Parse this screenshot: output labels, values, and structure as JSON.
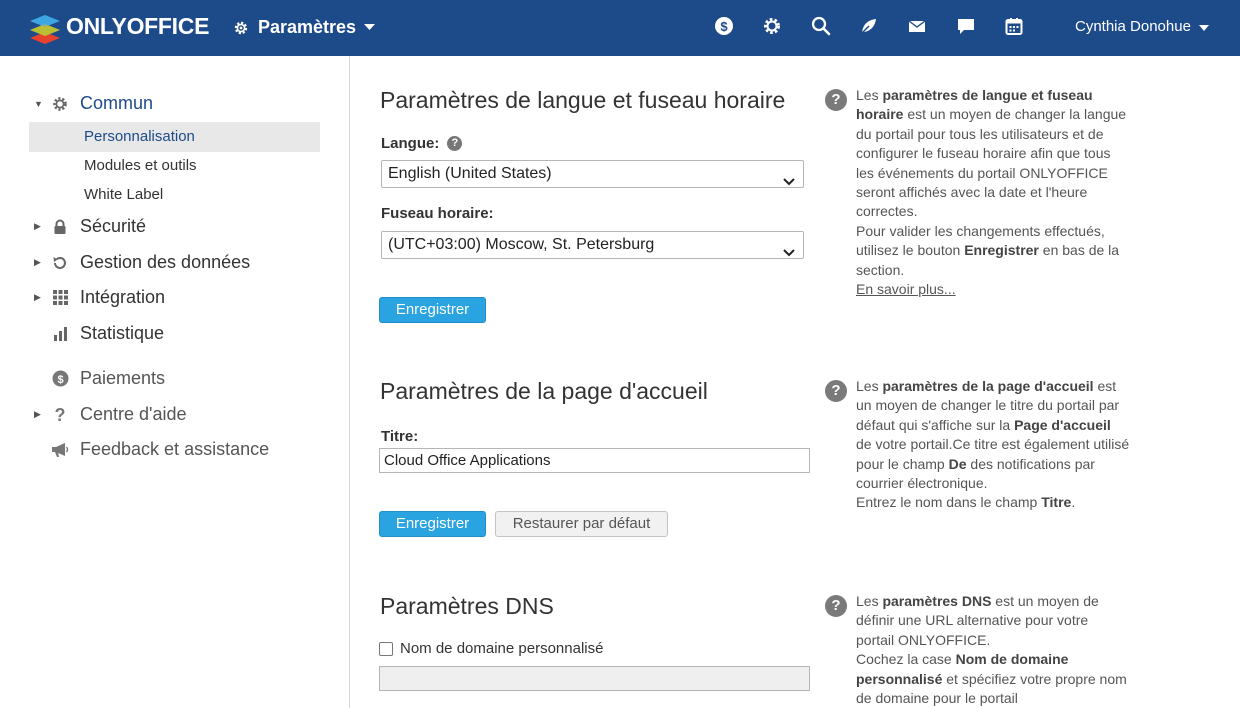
{
  "header": {
    "logo_text": "ONLYOFFICE",
    "module": "Paramètres",
    "user": "Cynthia Donohue",
    "icons": [
      "dollar-icon",
      "gear-icon",
      "search-icon",
      "feed-icon",
      "mail-icon",
      "chat-icon",
      "calendar-icon"
    ],
    "colors": {
      "bar": "#1d4b8a",
      "accent": "#2aa3e1"
    }
  },
  "sidebar": {
    "commun": "Commun",
    "sub": [
      "Personnalisation",
      "Modules et outils",
      "White Label"
    ],
    "securite": "Sécurité",
    "gestion": "Gestion des données",
    "integration": "Intégration",
    "statistique": "Statistique",
    "paiements": "Paiements",
    "centre_aide": "Centre d'aide",
    "feedback": "Feedback et assistance"
  },
  "langue_section": {
    "title": "Paramètres de langue et fuseau horaire",
    "language_label": "Langue:",
    "language_value": "English (United States)",
    "timezone_label": "Fuseau horaire:",
    "timezone_value": "(UTC+03:00) Moscow, St. Petersburg",
    "save": "Enregistrer",
    "help": {
      "p1": "Les ",
      "b1": "paramètres de langue et fuseau horaire",
      "p2": " est un moyen de changer la langue du portail pour tous les utilisateurs et de configurer le fuseau horaire afin que tous les événements du portail ONLYOFFICE seront affichés avec la date et l'heure correctes.",
      "p3": "Pour valider les changements effectués, utilisez le bouton ",
      "b2": "Enregistrer",
      "p4": " en bas de la section.",
      "link": "En savoir plus..."
    }
  },
  "accueil_section": {
    "title": "Paramètres de la page d'accueil",
    "title_label": "Titre:",
    "title_value": "Cloud Office Applications",
    "save": "Enregistrer",
    "restore": "Restaurer par défaut",
    "help": {
      "p1": "Les ",
      "b1": "paramètres de la page d'accueil",
      "p2": " est un moyen de changer le titre du portail par défaut qui s'affiche sur la ",
      "b2": "Page d'accueil",
      "p3": " de votre portail.Ce titre est également utilisé pour le champ ",
      "b3": "De",
      "p4": " des notifications par courrier électronique.",
      "p5": "Entrez le nom dans le champ ",
      "b4": "Titre",
      "p6": "."
    }
  },
  "dns_section": {
    "title": "Paramètres DNS",
    "checkbox_label": "Nom de domaine personnalisé",
    "domain_value": "",
    "help": {
      "p1": "Les ",
      "b1": "paramètres DNS",
      "p2": " est un moyen de définir une URL alternative pour votre portail ONLYOFFICE.",
      "p3": "Cochez la case ",
      "b2": "Nom de domaine personnalisé",
      "p4": " et spécifiez votre propre nom de domaine pour le portail"
    }
  }
}
